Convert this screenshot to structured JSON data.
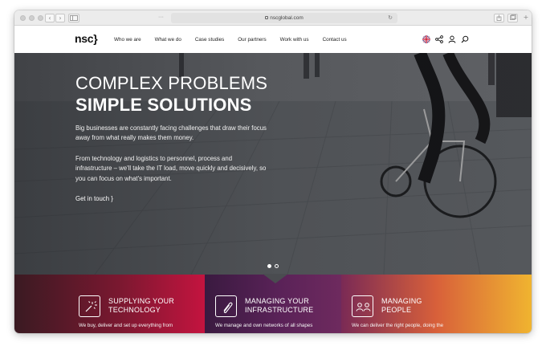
{
  "browser": {
    "url": "nscglobal.com",
    "nav_back": "‹",
    "nav_forward": "›",
    "more": "···",
    "reload": "↻"
  },
  "header": {
    "logo": "nsc}",
    "menu": [
      {
        "label": "Who we are"
      },
      {
        "label": "What we do"
      },
      {
        "label": "Case studies"
      },
      {
        "label": "Our partners"
      },
      {
        "label": "Work with us"
      },
      {
        "label": "Contact us"
      }
    ],
    "icons": [
      "uk-flag-icon",
      "share-icon",
      "user-icon",
      "search-icon"
    ]
  },
  "hero": {
    "title_line1": "COMPLEX PROBLEMS",
    "title_line2": "SIMPLE SOLUTIONS",
    "paragraph1": "Big businesses are constantly facing challenges that draw their focus away from what really makes them money.",
    "paragraph2": "From technology and logistics to personnel, process and infrastructure – we'll take the IT load, move quickly and decisively, so you can focus on what's important.",
    "cta": "Get in touch }",
    "slides": 2,
    "active_slide": 1
  },
  "services": [
    {
      "title_line1": "SUPPLYING YOUR",
      "title_line2": "TECHNOLOGY",
      "desc": "We buy, deliver and set up everything from",
      "icon": "magic-wand-icon",
      "color": "#c4143f"
    },
    {
      "title_line1": "MANAGING YOUR",
      "title_line2": "INFRASTRUCTURE",
      "desc": "We manage and own networks of all shapes",
      "icon": "paperclip-icon",
      "color": "#6e2a5e"
    },
    {
      "title_line1": "MANAGING",
      "title_line2": "PEOPLE",
      "desc": "We can deliver the right people, doing the",
      "icon": "people-icon",
      "color": "#f0b430"
    }
  ]
}
